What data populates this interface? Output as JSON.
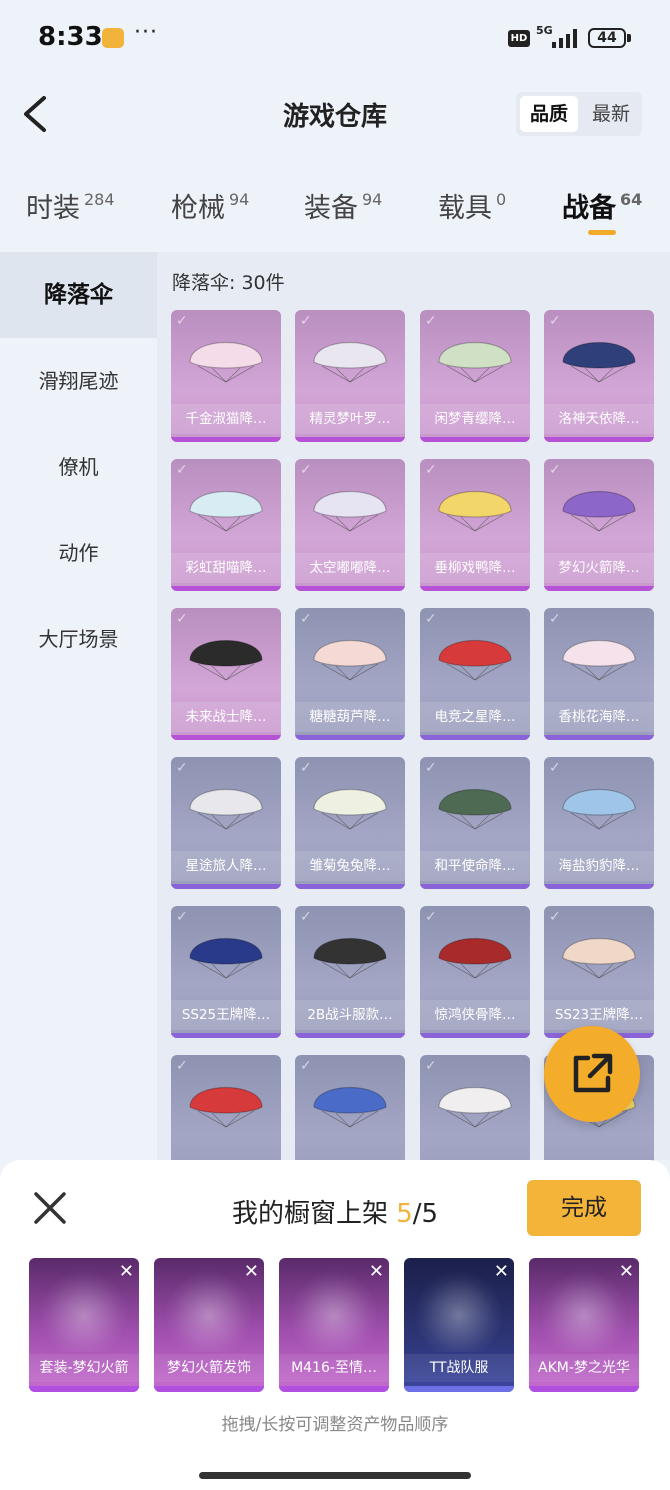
{
  "status": {
    "time": "8:33",
    "dots": "···",
    "hd": "HD",
    "network": "5G",
    "battery": "44",
    "icons": [
      "app-notification-icon",
      "signal-icon",
      "battery-icon"
    ]
  },
  "header": {
    "title": "游戏仓库",
    "sort": [
      "品质",
      "最新"
    ],
    "back_icon": "back-icon"
  },
  "tabs": [
    {
      "label": "时装",
      "count": "284"
    },
    {
      "label": "枪械",
      "count": "94"
    },
    {
      "label": "装备",
      "count": "94"
    },
    {
      "label": "载具",
      "count": "0"
    },
    {
      "label": "战备",
      "count": "64"
    }
  ],
  "sidebar": [
    "降落伞",
    "滑翔尾迹",
    "僚机",
    "动作",
    "大厅场景"
  ],
  "section_label": "降落伞: 30件",
  "items": [
    {
      "name": "千金淑猫降…",
      "rarity": "purple",
      "color": "#f4dce8"
    },
    {
      "name": "精灵梦叶罗…",
      "rarity": "purple",
      "color": "#e9e6ef"
    },
    {
      "name": "闲梦青缨降…",
      "rarity": "purple",
      "color": "#cfe0c4"
    },
    {
      "name": "洛神天依降…",
      "rarity": "purple",
      "color": "#2f3f7a"
    },
    {
      "name": "彩虹甜喵降…",
      "rarity": "purple",
      "color": "#d8ecf4"
    },
    {
      "name": "太空嘟嘟降…",
      "rarity": "purple",
      "color": "#e6e4f2"
    },
    {
      "name": "垂柳戏鸭降…",
      "rarity": "purple",
      "color": "#f2d66a"
    },
    {
      "name": "梦幻火箭降…",
      "rarity": "purple",
      "color": "#8c66c8"
    },
    {
      "name": "未来战士降…",
      "rarity": "purple",
      "color": "#2b2b2b"
    },
    {
      "name": "糖糖葫芦降…",
      "rarity": "blue",
      "color": "#f4d9d4"
    },
    {
      "name": "电竞之星降…",
      "rarity": "blue",
      "color": "#d63a3a"
    },
    {
      "name": "香桃花海降…",
      "rarity": "blue",
      "color": "#f6e2ea"
    },
    {
      "name": "星途旅人降…",
      "rarity": "blue",
      "color": "#e8e8ec"
    },
    {
      "name": "雏菊兔兔降…",
      "rarity": "blue",
      "color": "#eef0e2"
    },
    {
      "name": "和平使命降…",
      "rarity": "blue",
      "color": "#4f6a52"
    },
    {
      "name": "海盐豹豹降…",
      "rarity": "blue",
      "color": "#9fc6e8"
    },
    {
      "name": "SS25王牌降…",
      "rarity": "blue",
      "color": "#2a3a8a"
    },
    {
      "name": "2B战斗服款…",
      "rarity": "blue",
      "color": "#333333"
    },
    {
      "name": "惊鸿侠骨降…",
      "rarity": "blue",
      "color": "#a82a2a"
    },
    {
      "name": "SS23王牌降…",
      "rarity": "blue",
      "color": "#f0d8c8"
    },
    {
      "name": "",
      "rarity": "blue",
      "color": "#d63a3a"
    },
    {
      "name": "",
      "rarity": "blue",
      "color": "#4a6cc8"
    },
    {
      "name": "",
      "rarity": "blue",
      "color": "#f0eeee"
    },
    {
      "name": "",
      "rarity": "blue",
      "color": "#f2d66a"
    }
  ],
  "fab_icon": "share-export-icon",
  "showcase": {
    "title_prefix": "我的橱窗上架 ",
    "current": "5",
    "separator": "/",
    "total": "5",
    "done": "完成",
    "hint": "拖拽/长按可调整资产物品顺序",
    "slots": [
      {
        "name": "套装-梦幻火箭",
        "rarity": "purple"
      },
      {
        "name": "梦幻火箭发饰",
        "rarity": "purple"
      },
      {
        "name": "M416-至情…",
        "rarity": "purple"
      },
      {
        "name": "TT战队服",
        "rarity": "blue"
      },
      {
        "name": "AKM-梦之光华",
        "rarity": "purple"
      }
    ]
  }
}
